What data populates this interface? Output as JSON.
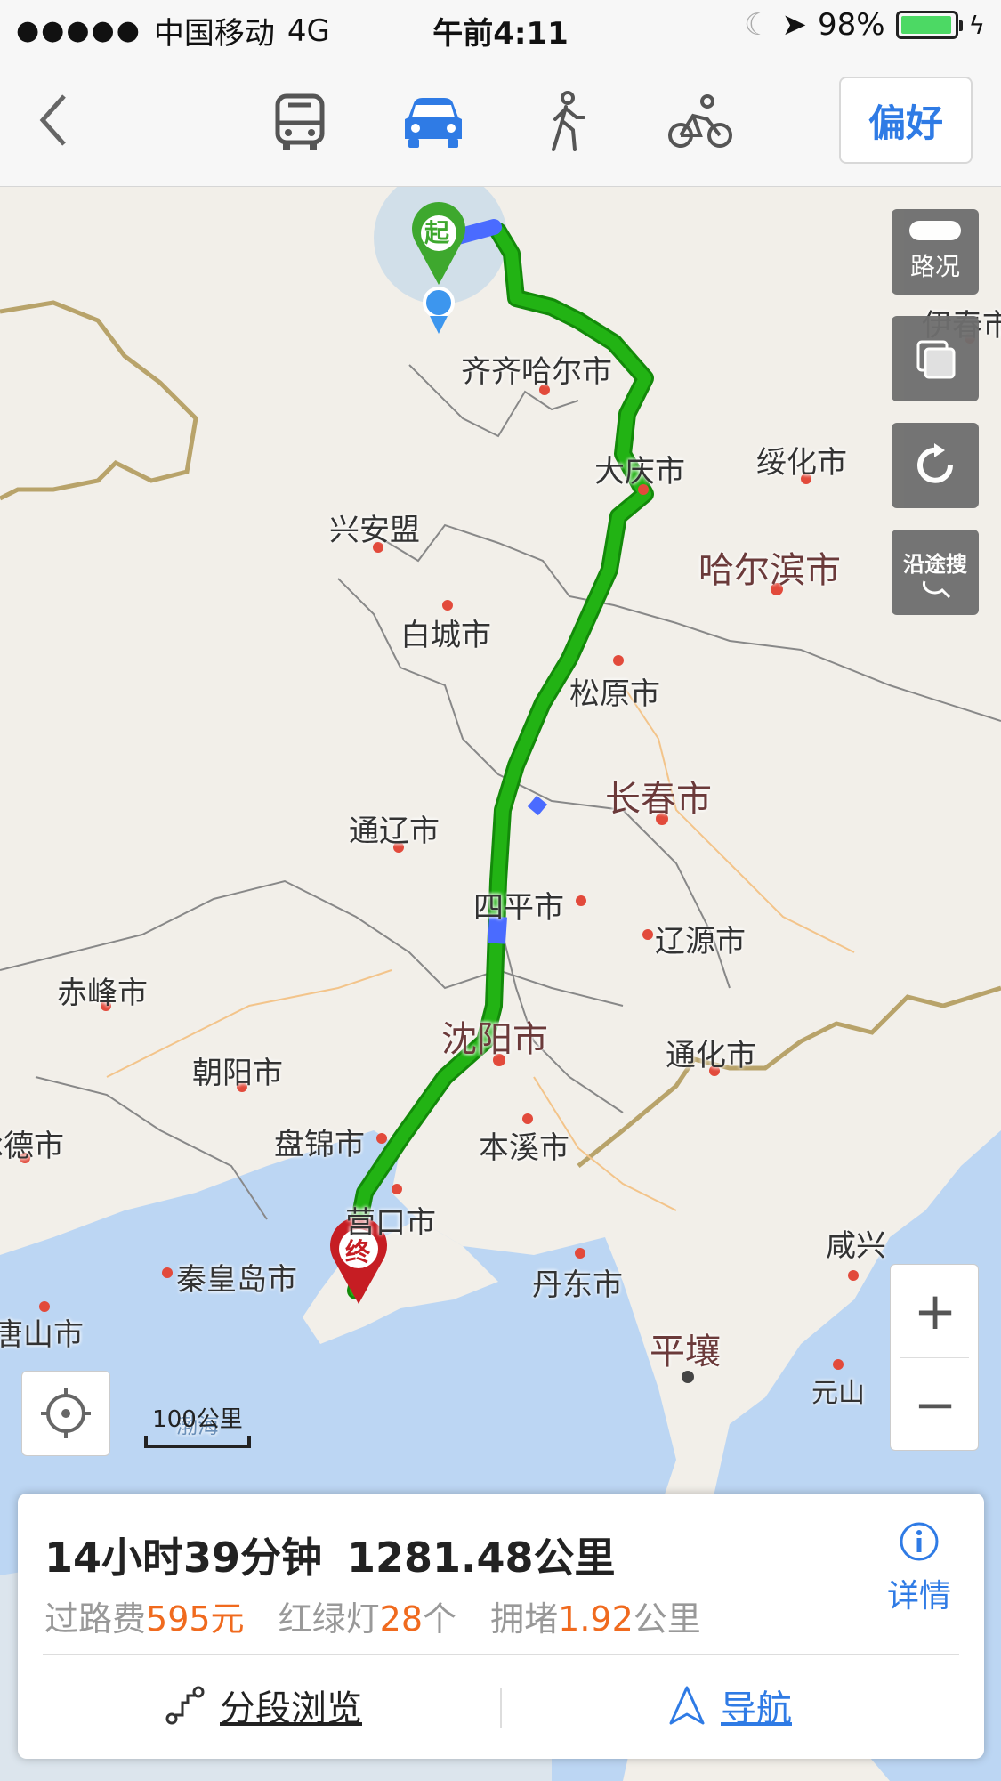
{
  "status_bar": {
    "signal": "●●●●●",
    "carrier": "中国移动",
    "network": "4G",
    "time": "午前4:11",
    "battery": "98%",
    "battery_level": 0.98
  },
  "toolbar": {
    "modes": [
      "bus",
      "car",
      "walk",
      "bicycle"
    ],
    "active_mode": "car",
    "preference_label": "偏好"
  },
  "map": {
    "cities": [
      {
        "name": "齐齐哈尔市",
        "size": "normal"
      },
      {
        "name": "大庆市",
        "size": "normal"
      },
      {
        "name": "绥化市",
        "size": "normal"
      },
      {
        "name": "伊春市",
        "size": "normal"
      },
      {
        "name": "兴安盟",
        "size": "normal"
      },
      {
        "name": "哈尔滨市",
        "size": "big"
      },
      {
        "name": "白城市",
        "size": "normal"
      },
      {
        "name": "松原市",
        "size": "normal"
      },
      {
        "name": "长春市",
        "size": "big"
      },
      {
        "name": "通辽市",
        "size": "normal"
      },
      {
        "name": "四平市",
        "size": "normal"
      },
      {
        "name": "辽源市",
        "size": "normal"
      },
      {
        "name": "赤峰市",
        "size": "normal"
      },
      {
        "name": "沈阳市",
        "size": "big"
      },
      {
        "name": "通化市",
        "size": "normal"
      },
      {
        "name": "朝阳市",
        "size": "normal"
      },
      {
        "name": "承德市",
        "size": "normal"
      },
      {
        "name": "盘锦市",
        "size": "normal"
      },
      {
        "name": "本溪市",
        "size": "normal"
      },
      {
        "name": "营口市",
        "size": "normal"
      },
      {
        "name": "秦皇岛市",
        "size": "normal"
      },
      {
        "name": "丹东市",
        "size": "normal"
      },
      {
        "name": "咸兴",
        "size": "normal"
      },
      {
        "name": "唐山市",
        "size": "normal"
      },
      {
        "name": "平壤",
        "size": "big"
      },
      {
        "name": "元山",
        "size": "normal"
      },
      {
        "name": "渤海",
        "size": "water"
      }
    ],
    "start_marker": "起",
    "end_marker": "终",
    "traffic_label": "路况",
    "along_route_search_label": "沿途搜",
    "scale_label": "100公里",
    "zoom_in": "+",
    "zoom_out": "−"
  },
  "route": {
    "duration": "14小时39分钟",
    "distance": "1281.48公里",
    "toll_label": "过路费",
    "toll_value": "595",
    "toll_unit": "元",
    "lights_label": "红绿灯",
    "lights_value": "28",
    "lights_unit": "个",
    "congestion_label": "拥堵",
    "congestion_value": "1.92",
    "congestion_unit": "公里",
    "details_label": "详情",
    "segment_browse_label": "分段浏览",
    "navigate_label": "导航"
  },
  "colors": {
    "route": "#22b314",
    "route_slow": "#4a6bff",
    "accent": "#2f7be5",
    "highlight": "#f06a1e",
    "water": "#bcd6f3",
    "land": "#f2efe9",
    "border": "#b8a36a"
  }
}
